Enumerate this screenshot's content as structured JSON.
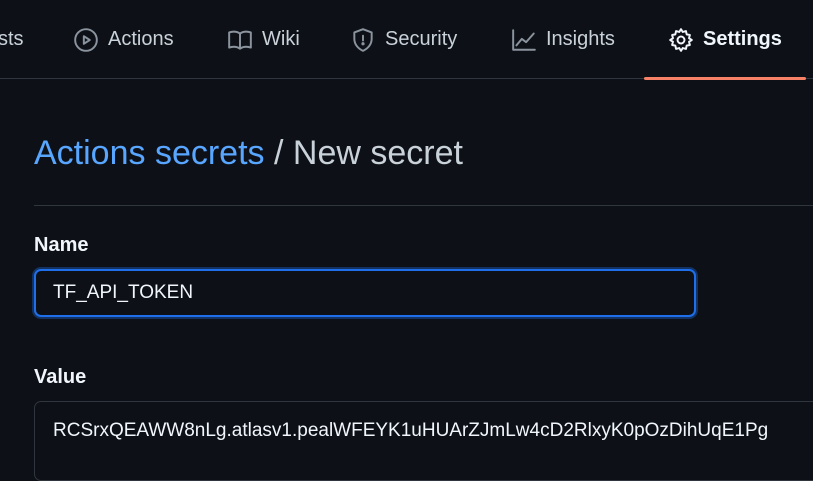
{
  "tabs": [
    {
      "label": "sts",
      "icon": "cut-off-icon"
    },
    {
      "label": "Actions",
      "icon": "play-icon"
    },
    {
      "label": "Wiki",
      "icon": "book-icon"
    },
    {
      "label": "Security",
      "icon": "shield-icon"
    },
    {
      "label": "Insights",
      "icon": "graph-icon"
    },
    {
      "label": "Settings",
      "icon": "gear-icon",
      "active": true
    }
  ],
  "breadcrumb": {
    "parent": "Actions secrets",
    "separator": "/",
    "current": "New secret"
  },
  "form": {
    "name_label": "Name",
    "name_value": "TF_API_TOKEN",
    "value_label": "Value",
    "value_text": "RCSrxQEAWW8nLg.atlasv1.pealWFEYK1uHUArZJmLw4cD2RlxyK0pOzDihUqE1Pg"
  },
  "colors": {
    "background": "#0d1117",
    "link": "#58a6ff",
    "active_underline": "#f78166",
    "focus_border": "#1f6feb"
  }
}
